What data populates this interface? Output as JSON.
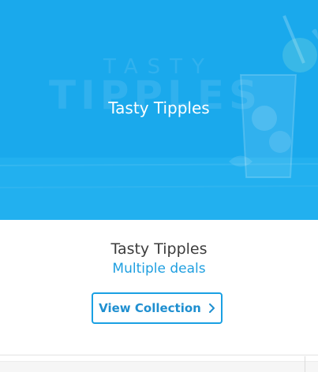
{
  "hero": {
    "title": "Tasty Tipples",
    "watermark_top": "TASTY",
    "watermark_main": "TIPPLES",
    "background_color": "#1aa9ec"
  },
  "info": {
    "title": "Tasty Tipples",
    "subtitle": "Multiple deals"
  },
  "button": {
    "label": "View Collection",
    "icon": "chevron-right-icon",
    "accent_color": "#1aa0e3"
  }
}
